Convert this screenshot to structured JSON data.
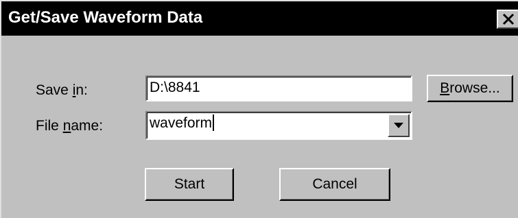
{
  "window": {
    "title": "Get/Save Waveform Data",
    "close_glyph": "✕"
  },
  "form": {
    "save_in": {
      "label_prefix": "Save ",
      "label_accel": "i",
      "label_suffix": "n:",
      "value": "D:\\8841"
    },
    "file_name": {
      "label_prefix": "File ",
      "label_accel": "n",
      "label_suffix": "ame:",
      "value": "waveform"
    },
    "browse_button": {
      "accel": "B",
      "rest": "rowse..."
    }
  },
  "buttons": {
    "start": "Start",
    "cancel": "Cancel"
  },
  "icons": {
    "close": "close-icon",
    "dropdown": "chevron-down-icon"
  },
  "colors": {
    "face": "#c0c0c0",
    "titlebar": "#000000",
    "title_text": "#ffffff"
  }
}
